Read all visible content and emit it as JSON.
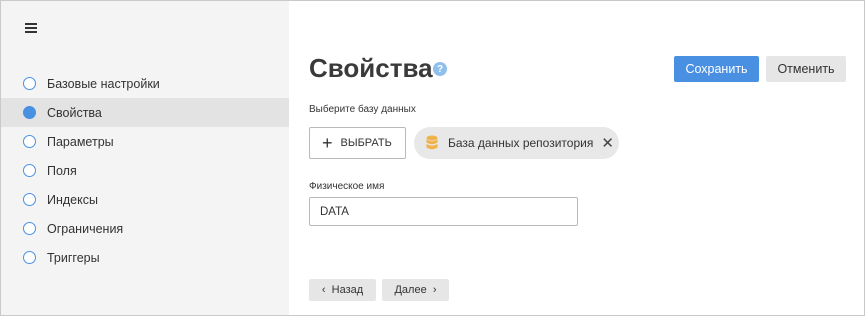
{
  "sidebar": {
    "items": [
      {
        "label": "Базовые настройки",
        "active": false
      },
      {
        "label": "Свойства",
        "active": true
      },
      {
        "label": "Параметры",
        "active": false
      },
      {
        "label": "Поля",
        "active": false
      },
      {
        "label": "Индексы",
        "active": false
      },
      {
        "label": "Ограничения",
        "active": false
      },
      {
        "label": "Триггеры",
        "active": false
      }
    ]
  },
  "main": {
    "title": "Свойства",
    "help_icon": "question-circle",
    "save_label": "Сохранить",
    "cancel_label": "Отменить",
    "select_db_label": "Выберите базу данных",
    "select_button_label": "ВЫБРАТЬ",
    "chip_label": "База данных репозитория",
    "physical_name_label": "Физическое имя",
    "physical_name_value": "DATA",
    "back_label": "Назад",
    "next_label": "Далее"
  },
  "colors": {
    "accent": "#4a90e2",
    "db_icon": "#f0b24a"
  }
}
